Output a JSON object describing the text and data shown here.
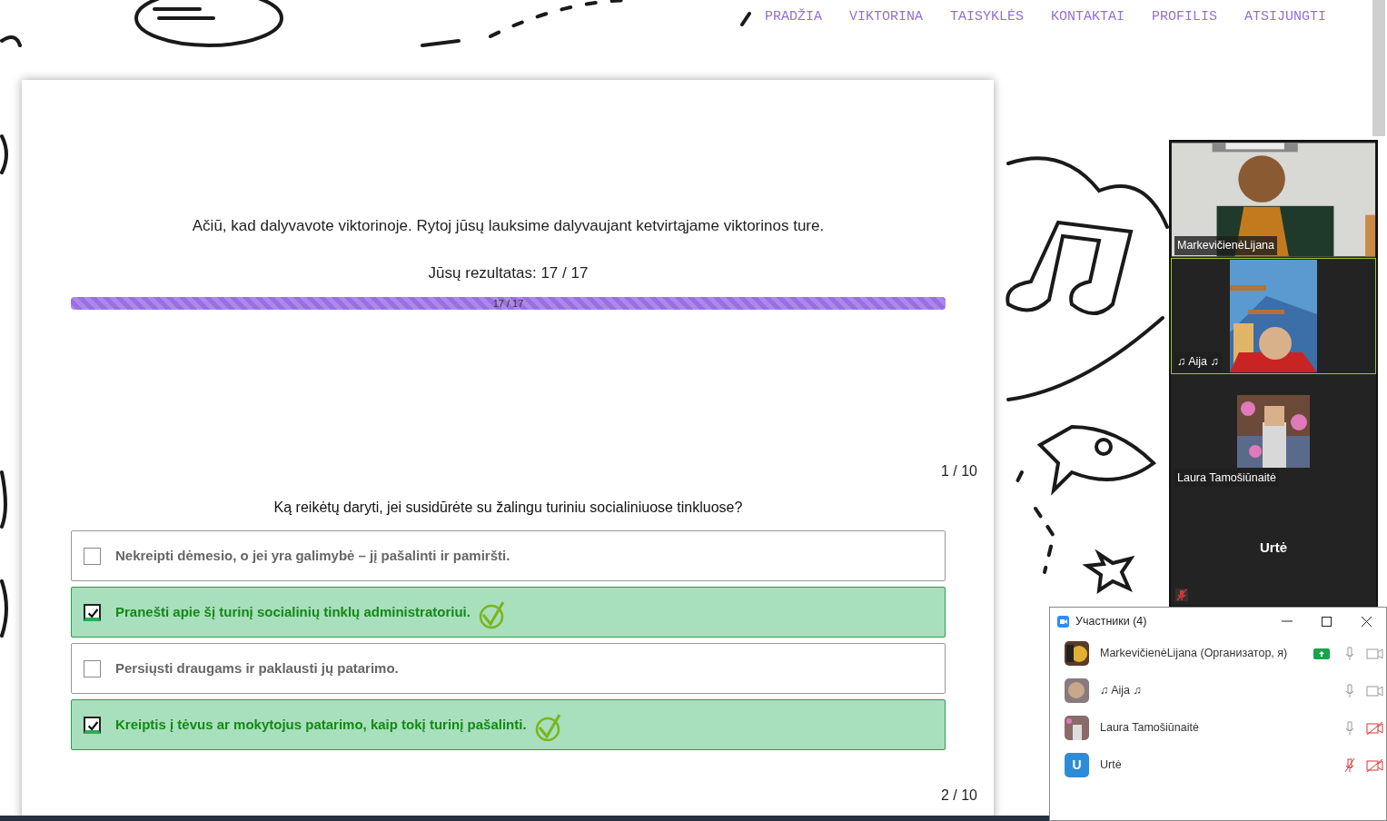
{
  "nav": [
    {
      "label": "PRADŽIA"
    },
    {
      "label": "VIKTORINA"
    },
    {
      "label": "TAISYKLĖS"
    },
    {
      "label": "KONTAKTAI"
    },
    {
      "label": "PROFILIS"
    },
    {
      "label": "ATSIJUNGTI"
    }
  ],
  "quiz": {
    "message": "Ačiū, kad dalyvavote viktorinoje. Rytoj jūsų lauksime dalyvaujant ketvirtąjame viktorinos ture.",
    "score": "Jūsų rezultatas: 17 / 17",
    "progress": {
      "level": 1,
      "label": "17 / 17"
    },
    "question": {
      "counter": "1 / 10",
      "text": "Ką reikėtų daryti, jei susidūrėte su žalingu turiniu socialiniuose tinkluose?",
      "options": [
        {
          "text": "Nekreipti dėmesio, o jei yra galimybė – jį pašalinti ir pamiršti.",
          "checked": false,
          "correct": false
        },
        {
          "text": "Pranešti apie šį turinį socialinių tinklų administratoriui.",
          "checked": true,
          "correct": true
        },
        {
          "text": "Persiųsti draugams ir paklausti jų patarimo.",
          "checked": false,
          "correct": false
        },
        {
          "text": "Kreiptis į tėvus ar mokytojus patarimo, kaip tokį turinį pašalinti.",
          "checked": true,
          "correct": true
        }
      ]
    },
    "next_counter": "2 / 10"
  },
  "video_tiles": [
    {
      "name": "MarkevičienėLijana",
      "kind": "video",
      "selected": false,
      "mic_muted": false
    },
    {
      "name": "♫ Aija ♫",
      "kind": "narrow",
      "selected": true,
      "mic_muted": false
    },
    {
      "name": "Laura Tamošiūnaitė",
      "kind": "avatar",
      "selected": false,
      "mic_muted": false
    },
    {
      "name": "Urtė",
      "kind": "name",
      "selected": false,
      "mic_muted": true
    }
  ],
  "participants": {
    "title": "Участники (4)",
    "rows": [
      {
        "name": "MarkevičienėLijana (Организатор, я)",
        "kind": "picture",
        "sharing": true,
        "mic_muted": false,
        "video_off": false
      },
      {
        "name": "♫ Aija ♫",
        "kind": "picture",
        "sharing": false,
        "mic_muted": false,
        "video_off": false
      },
      {
        "name": "Laura Tamošiūnaitė",
        "kind": "picture",
        "sharing": false,
        "mic_muted": false,
        "video_off": true
      },
      {
        "name": "Urtė",
        "kind": "letter",
        "initial": "U",
        "color": "#2d8cd8",
        "sharing": false,
        "mic_muted": true,
        "video_off": true
      }
    ]
  }
}
